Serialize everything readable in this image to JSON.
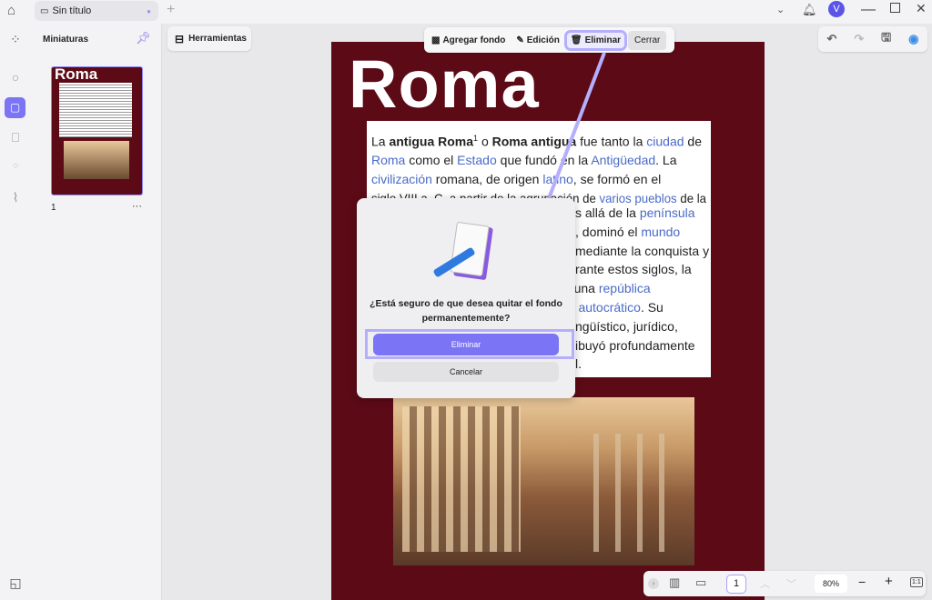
{
  "tab": {
    "title": "Sin título"
  },
  "panel": {
    "title": "Miniaturas",
    "page_number": "1",
    "more": "···",
    "thumb_title": "Roma"
  },
  "tools_button": "Herramientas",
  "toolbar": {
    "add_background": "Agregar fondo",
    "edit": "Edición",
    "remove": "Eliminar",
    "close": "Cerrar"
  },
  "avatar": "V",
  "document": {
    "title": "Roma",
    "line1": {
      "a": "La ",
      "b": "antigua Roma",
      "sup": "1",
      "c": " o ",
      "d": "Roma antigua",
      "e": " fue tanto la ",
      "f": "ciudad",
      "g": " de"
    },
    "line2": {
      "a": "Roma",
      "b": " como el ",
      "c": "Estado",
      "d": " que fundó en la ",
      "e": "Antigüedad",
      "f": ". La"
    },
    "line3": {
      "a": "civilización",
      "b": " romana, de origen ",
      "c": "latino",
      "d": ", se formó en el"
    },
    "line4": {
      "a": "siglo VIII a. C. a partir de la agrupación de ",
      "b": "varios pueblos",
      "c": " de la"
    },
    "fragments": [
      {
        "a": "s allá de la ",
        "b": "península",
        "c": ""
      },
      {
        "a": ", dominó el ",
        "b": "mundo",
        "c": ""
      },
      {
        "a": "mediante la conquista y",
        "b": "",
        "c": ""
      },
      {
        "a": "rante estos siglos, la",
        "b": "",
        "c": ""
      },
      {
        "a": "",
        "b": "a",
        "c": ", una "
      },
      {
        "a": "",
        "b": "rio autocrático",
        "c": ". Su"
      },
      {
        "a": "ngüístico, jurídico,",
        "b": "",
        "c": ""
      },
      {
        "a": "ibuyó profundamente",
        "b": "",
        "c": ""
      },
      {
        "a": "l.",
        "b": "",
        "c": ""
      }
    ],
    "republica": "república"
  },
  "dialog": {
    "message": "¿Está seguro de que desea quitar el fondo permanentemente?",
    "confirm": "Eliminar",
    "cancel": "Cancelar"
  },
  "bottombar": {
    "page": "1",
    "zoom": "80%",
    "minus": "−",
    "plus": "+",
    "fit": "1:1"
  },
  "colors": {
    "accent": "#7b74f5",
    "page_bg": "#5c0a16",
    "link": "#4a6bc8"
  }
}
